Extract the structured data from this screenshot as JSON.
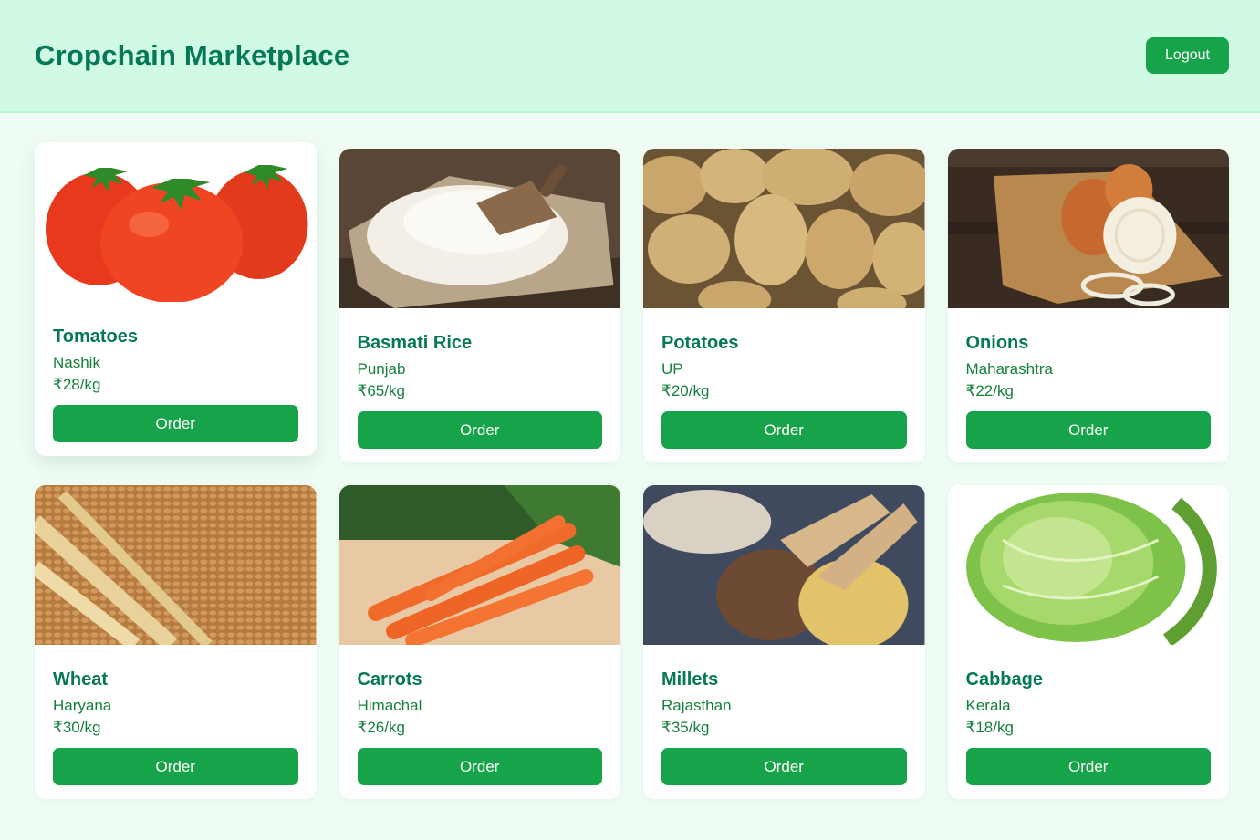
{
  "header": {
    "title": "Cropchain Marketplace",
    "logout_label": "Logout"
  },
  "products": [
    {
      "name": "Tomatoes",
      "region": "Nashik",
      "price": "₹28/kg",
      "order_label": "Order",
      "image_icon": "tomatoes-image"
    },
    {
      "name": "Basmati Rice",
      "region": "Punjab",
      "price": "₹65/kg",
      "order_label": "Order",
      "image_icon": "basmati-rice-image"
    },
    {
      "name": "Potatoes",
      "region": "UP",
      "price": "₹20/kg",
      "order_label": "Order",
      "image_icon": "potatoes-image"
    },
    {
      "name": "Onions",
      "region": "Maharashtra",
      "price": "₹22/kg",
      "order_label": "Order",
      "image_icon": "onions-image"
    },
    {
      "name": "Wheat",
      "region": "Haryana",
      "price": "₹30/kg",
      "order_label": "Order",
      "image_icon": "wheat-image"
    },
    {
      "name": "Carrots",
      "region": "Himachal",
      "price": "₹26/kg",
      "order_label": "Order",
      "image_icon": "carrots-image"
    },
    {
      "name": "Millets",
      "region": "Rajasthan",
      "price": "₹35/kg",
      "order_label": "Order",
      "image_icon": "millets-image"
    },
    {
      "name": "Cabbage",
      "region": "Kerala",
      "price": "₹18/kg",
      "order_label": "Order",
      "image_icon": "cabbage-image"
    }
  ],
  "colors": {
    "header_bg": "#d1fae5",
    "page_bg": "#effcf3",
    "accent": "#16a34a",
    "title": "#047857"
  }
}
